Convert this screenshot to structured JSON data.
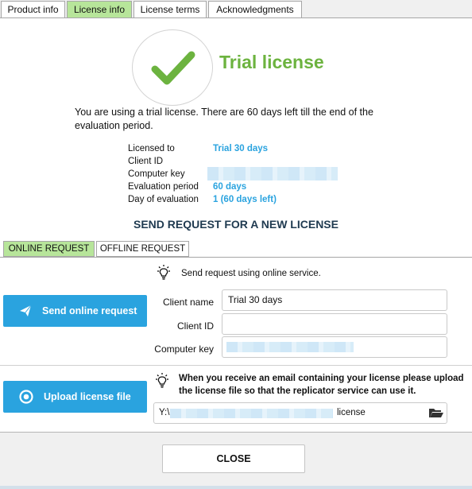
{
  "tabs": [
    {
      "label": "Product info",
      "active": false
    },
    {
      "label": "License info",
      "active": true
    },
    {
      "label": "License terms",
      "active": false
    },
    {
      "label": "Acknowledgments",
      "active": false
    }
  ],
  "license": {
    "status_title": "Trial license",
    "status_icon": "checkmark-icon",
    "message": "You are using a trial license. There are 60 days left till the end of the evaluation period.",
    "fields": [
      {
        "label": "Licensed to",
        "value": "Trial 30 days"
      },
      {
        "label": "Client ID",
        "value": ""
      },
      {
        "label": "Computer key",
        "value": ""
      },
      {
        "label": "Evaluation period",
        "value": "60 days"
      },
      {
        "label": "Day of evaluation",
        "value": "1 (60 days left)"
      }
    ]
  },
  "request": {
    "title": "SEND REQUEST FOR A NEW LICENSE",
    "subtabs": [
      {
        "label": "ONLINE REQUEST",
        "active": true
      },
      {
        "label": "OFFLINE REQUEST",
        "active": false
      }
    ],
    "online_hint": "Send request using online service.",
    "send_button": "Send online request",
    "form": {
      "client_name_label": "Client name",
      "client_name_value": "Trial 30 days",
      "client_id_label": "Client ID",
      "client_id_value": "",
      "computer_key_label": "Computer key"
    },
    "upload_hint_line1": "When you receive an email containing your license please upload",
    "upload_hint_line2": "the license file so that the replicator service can use it.",
    "upload_button": "Upload license file",
    "license_path_prefix": "Y:\\",
    "license_path_suffix": "license"
  },
  "close_label": "CLOSE",
  "colors": {
    "accent": "#2aa3df",
    "success": "#6cb33f",
    "active_tab": "#b7e59a",
    "heading": "#1f3a50"
  }
}
